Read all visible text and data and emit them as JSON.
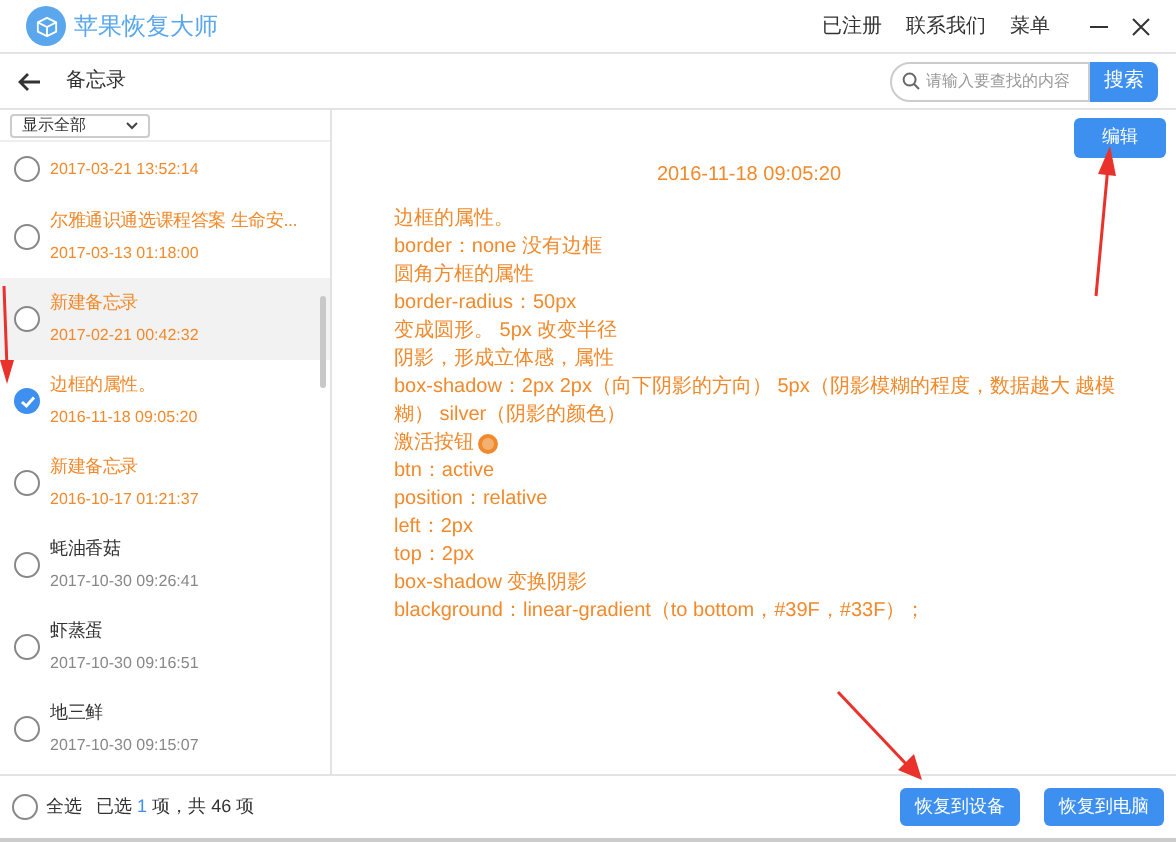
{
  "app": {
    "title": "苹果恢复大师",
    "menu": [
      "已注册",
      "联系我们",
      "菜单"
    ]
  },
  "toolbar": {
    "title": "备忘录",
    "search": {
      "placeholder": "请输入要查找的内容"
    },
    "search_button": "搜索"
  },
  "filter": {
    "value": "显示全部"
  },
  "notes": [
    {
      "date": "2017-03-21 13:52:14",
      "kind": "deleted",
      "checked": false,
      "hovered": false
    },
    {
      "title": "尔雅通识通选课程答案 生命安...",
      "date": "2017-03-13 01:18:00",
      "kind": "deleted",
      "checked": false,
      "hovered": false
    },
    {
      "title": "新建备忘录",
      "date": "2017-02-21 00:42:32",
      "kind": "deleted",
      "checked": false,
      "hovered": true
    },
    {
      "title": "边框的属性。",
      "date": "2016-11-18 09:05:20",
      "kind": "deleted",
      "checked": true,
      "hovered": false
    },
    {
      "title": "新建备忘录",
      "date": "2016-10-17 01:21:37",
      "kind": "deleted",
      "checked": false,
      "hovered": false
    },
    {
      "title": "蚝油香菇",
      "date": "2017-10-30 09:26:41",
      "kind": "normal",
      "checked": false,
      "hovered": false
    },
    {
      "title": "虾蒸蛋",
      "date": "2017-10-30 09:16:51",
      "kind": "normal",
      "checked": false,
      "hovered": false
    },
    {
      "title": "地三鲜",
      "date": "2017-10-30 09:15:07",
      "kind": "normal",
      "checked": false,
      "hovered": false
    }
  ],
  "detail": {
    "edit_button": "编辑",
    "date": "2016-11-18 09:05:20",
    "lines": [
      {
        "text": "边框的属性。"
      },
      {
        "text": "border：none    没有边框"
      },
      {
        "text": "圆角方框的属性"
      },
      {
        "text": "border-radius：50px"
      },
      {
        "text": "变成圆形。          5px    改变半径"
      },
      {
        "text": "阴影，形成立体感，属性"
      },
      {
        "text": "box-shadow：2px      2px（向下阴影的方向）      5px（阴影模糊的程度，数据越大 越模糊） silver（阴影的颜色）"
      },
      {
        "text": "激活按钮",
        "icon": true
      },
      {
        "text": "btn：active"
      },
      {
        "text": "position：relative"
      },
      {
        "text": "left：2px"
      },
      {
        "text": "top：2px"
      },
      {
        "text": "box-shadow 变换阴影"
      },
      {
        "text": "blackground：linear-gradient（to bottom，#39F，#33F）；"
      }
    ]
  },
  "footer": {
    "select_all": {
      "label": "全选",
      "checked": false
    },
    "selected_prefix": "已选",
    "selected_count": "1",
    "selected_middle": "项，共",
    "total": "46",
    "selected_suffix": "项",
    "buttons": [
      "恢复到设备",
      "恢复到电脑"
    ]
  }
}
